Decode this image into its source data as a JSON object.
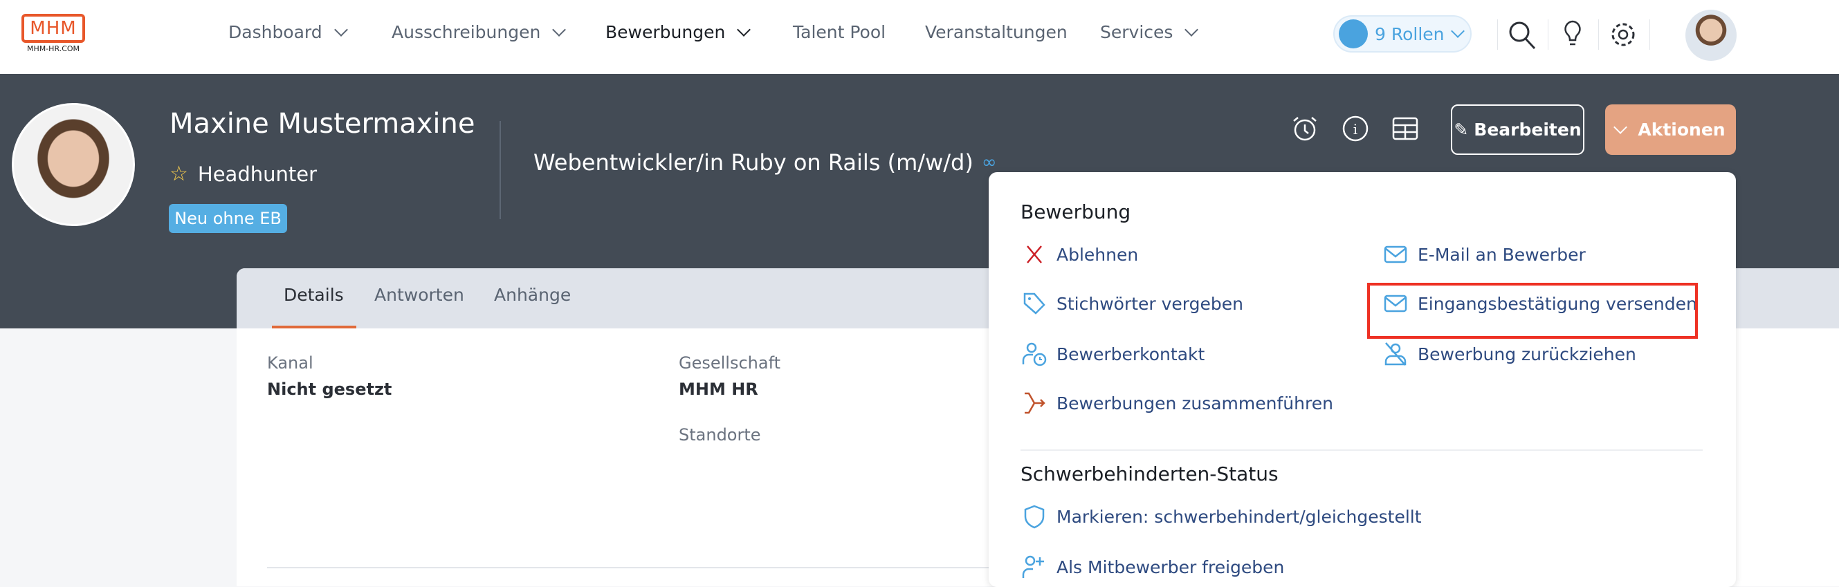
{
  "nav": {
    "logo": "MHM",
    "logo_sub": "MHM-HR.COM",
    "items": [
      {
        "label": "Dashboard"
      },
      {
        "label": "Ausschreibungen"
      },
      {
        "label": "Bewerbungen"
      },
      {
        "label": "Talent Pool"
      },
      {
        "label": "Veranstaltungen"
      },
      {
        "label": "Services"
      }
    ],
    "roles": "9 Rollen"
  },
  "profile": {
    "name": "Maxine Mustermaxine",
    "source": "Headhunter",
    "status_badge": "Neu ohne EB",
    "job": "Webentwickler/in Ruby on Rails (m/w/d)"
  },
  "actions": {
    "edit": "Bearbeiten",
    "actions": "Aktionen"
  },
  "tabs": [
    "Details",
    "Antworten",
    "Anhänge"
  ],
  "details": {
    "kanal_label": "Kanal",
    "kanal_value": "Nicht gesetzt",
    "gesellschaft_label": "Gesellschaft",
    "gesellschaft_value": "MHM HR",
    "standorte_label": "Standorte"
  },
  "dropdown": {
    "section1": "Bewerbung",
    "items": [
      "Ablehnen",
      "E-Mail an Bewerber",
      "Stichwörter vergeben",
      "Eingangsbestätigung versenden",
      "Bewerberkontakt",
      "Bewerbung zurückziehen",
      "Bewerbungen zusammenführen"
    ],
    "section2": "Schwerbehinderten-Status",
    "items2": [
      "Markieren: schwerbehindert/gleichgestellt",
      "Als Mitbewerber freigeben"
    ]
  },
  "colors": {
    "accent": "#e4a382",
    "band": "#434b55",
    "link": "#2e4a80",
    "icon": "#4aa3df",
    "highlight": "#ee3124"
  }
}
